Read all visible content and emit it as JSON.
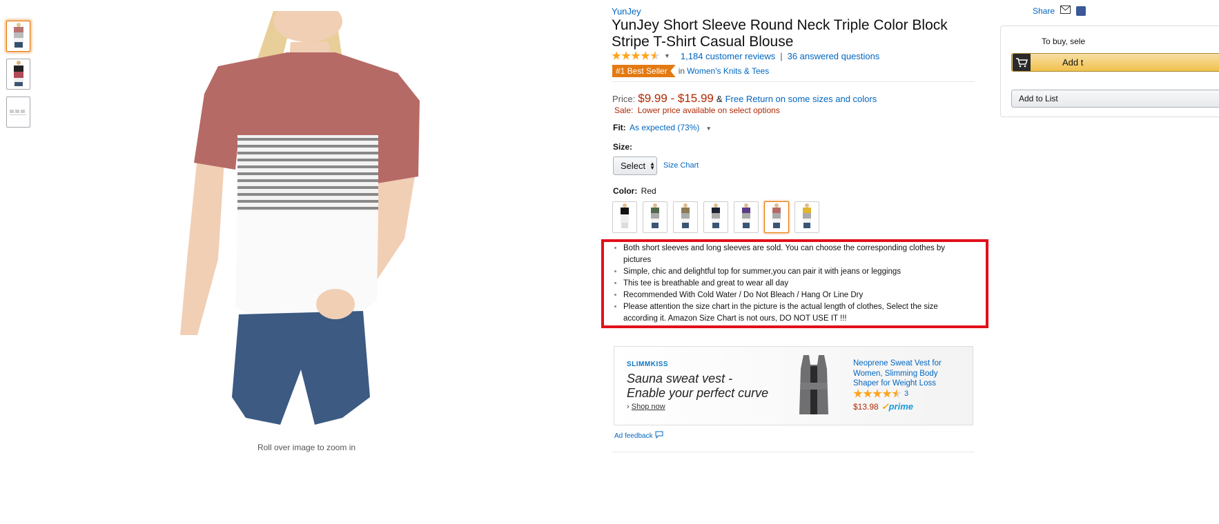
{
  "thumbnails": [
    {
      "label": "thumbnail 1",
      "selected": true
    },
    {
      "label": "thumbnail 2",
      "selected": false
    },
    {
      "label": "thumbnail 3",
      "selected": false
    }
  ],
  "main_image": {
    "zoom_hint": "Roll over image to zoom in"
  },
  "product": {
    "brand": "YunJey",
    "title": "YunJey Short Sleeve Round Neck Triple Color Block Stripe T-Shirt Casual Blouse",
    "rating": 4.5,
    "reviews_link": "1,184 customer reviews",
    "separator": "|",
    "questions_link": "36 answered questions",
    "badge": "#1 Best Seller",
    "badge_in": "in",
    "badge_category": "Women's Knits & Tees",
    "price_label": "Price:",
    "price": "$9.99 - $15.99",
    "price_amp": "&",
    "free_return": "Free Return on some sizes and colors",
    "sale_label": "Sale:",
    "sale_text": "Lower price available on select options",
    "fit_label": "Fit:",
    "fit_value": "As expected (73%)",
    "size_label": "Size:",
    "size_select": "Select",
    "size_chart": "Size Chart",
    "color_label": "Color:",
    "color_value": "Red",
    "swatches": [
      {
        "name": "black-white",
        "selected": false
      },
      {
        "name": "green",
        "selected": false
      },
      {
        "name": "khaki",
        "selected": false
      },
      {
        "name": "navy",
        "selected": false
      },
      {
        "name": "purple",
        "selected": false
      },
      {
        "name": "red",
        "selected": true
      },
      {
        "name": "yellow",
        "selected": false
      }
    ],
    "bullets": [
      "Both short sleeves and long sleeves are sold. You can choose the corresponding clothes by pictures",
      "Simple, chic and delightful top for summer,you can pair it with jeans or leggings",
      "This tee is breathable and great to wear all day",
      "Recommended With Cold Water / Do Not Bleach / Hang Or Line Dry",
      "Please attention the size chart in the picture is the actual length of clothes, Select the size according it. Amazon Size Chart is not ours, DO NOT USE IT !!!"
    ]
  },
  "ad": {
    "brand": "SLIMMKISS",
    "headline_line1": "Sauna sweat vest -",
    "headline_line2": "Enable your perfect curve",
    "shop_arrow": "›",
    "shop_now": "Shop now",
    "product_title": "Neoprene Sweat Vest for Women, Slimming Body Shaper for Weight Loss",
    "rating": 4.5,
    "rating_count": "3",
    "price": "$13.98",
    "prime": "prime",
    "feedback": "Ad feedback"
  },
  "buybox": {
    "share": "Share",
    "buy_text": "To buy, sele",
    "add_to_cart": "Add t",
    "add_to_list": "Add to List"
  },
  "colors": {
    "link": "#0066c0",
    "price": "#b12704",
    "badge": "#e47911",
    "highlight_box": "#e20f1b"
  }
}
